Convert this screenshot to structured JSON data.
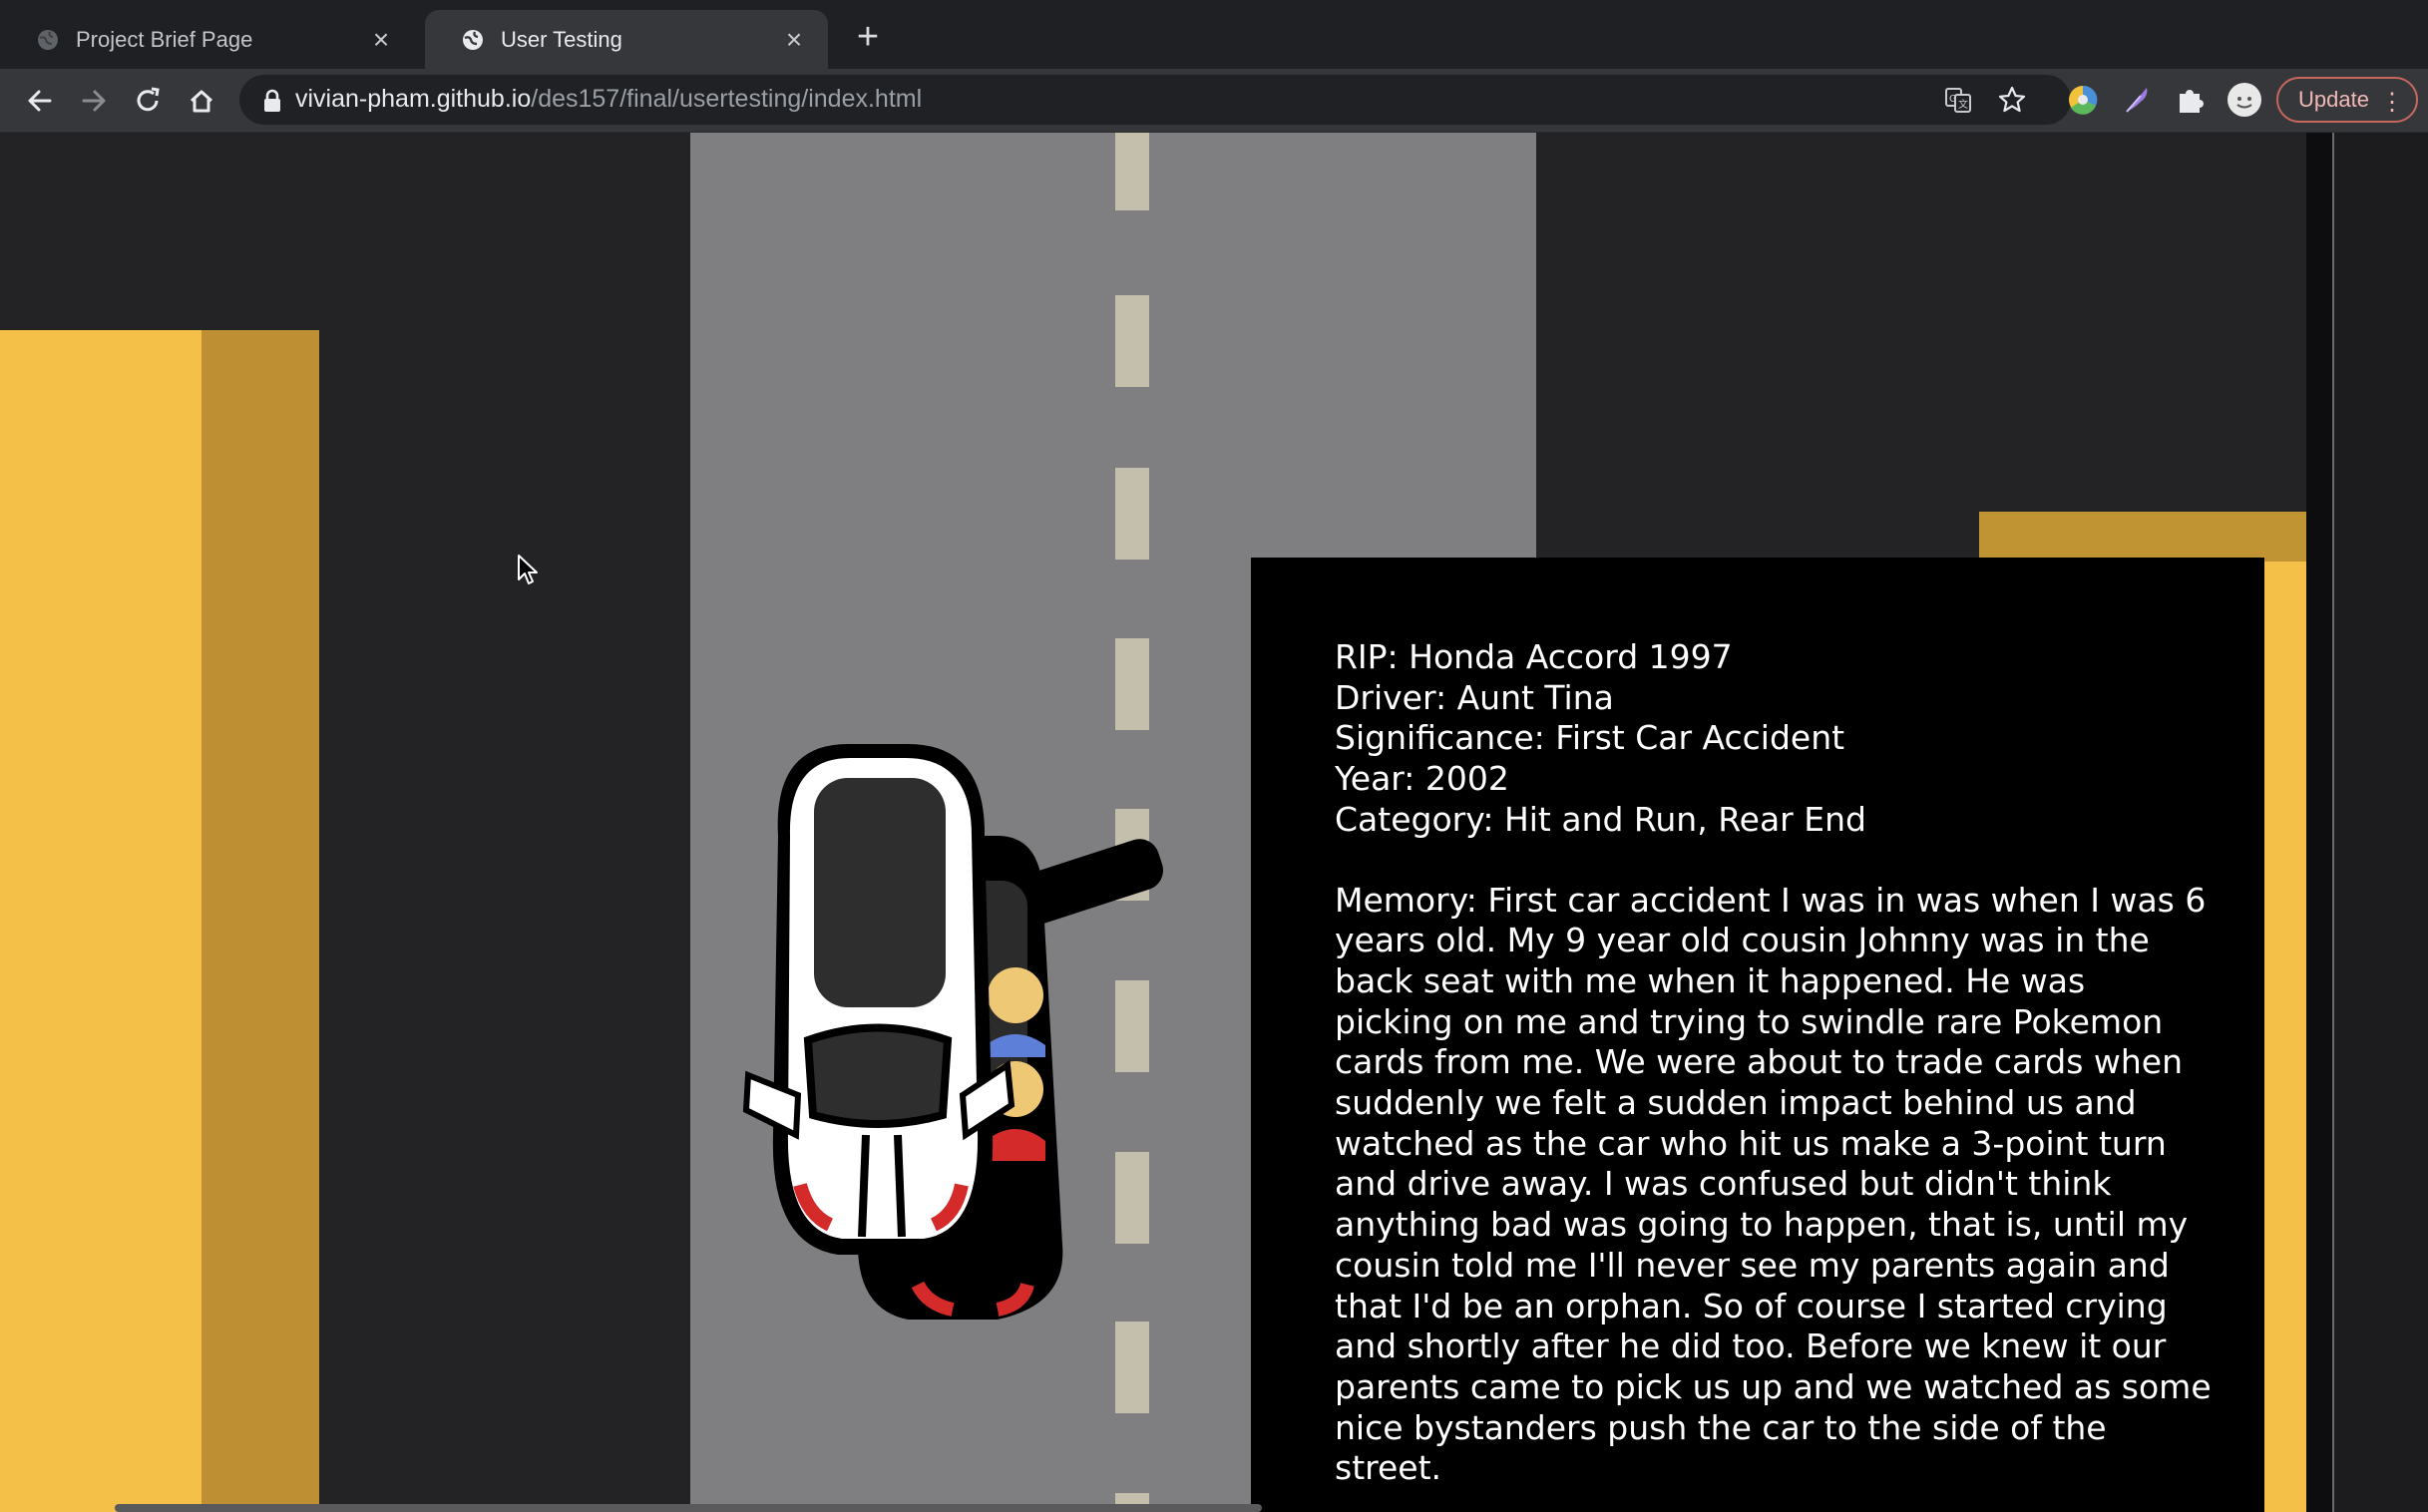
{
  "browser": {
    "tabs": [
      {
        "title": "Project Brief Page",
        "active": false
      },
      {
        "title": "User Testing",
        "active": true
      }
    ],
    "url_domain": "vivian-pham.github.io",
    "url_path": "/des157/final/usertesting/index.html",
    "update_label": "Update"
  },
  "icons": {
    "back": "back-arrow-icon",
    "forward": "forward-arrow-icon",
    "reload": "reload-icon",
    "home": "home-icon",
    "lock": "lock-icon",
    "translate": "translate-icon",
    "bookmark": "star-icon",
    "extensions": "puzzle-icon",
    "menu": "three-dots-icon"
  },
  "colors": {
    "road": "#7f7e80",
    "building_yellow": "#f4c047",
    "building_shadow": "#be9033",
    "lane_marking": "#c4bfac",
    "panel_bg": "#000000"
  },
  "memory_card": {
    "rip": "RIP: Honda Accord 1997",
    "driver": "Driver: Aunt Tina",
    "significance": "Significance: First Car Accident",
    "year": "Year: 2002",
    "category": "Category: Hit and Run, Rear End",
    "memory": "Memory: First car accident I was in was when I was 6 years old. My 9 year old cousin Johnny was in the back seat with me when it happened. He was picking on me and trying to swindle rare Pokemon cards from me. We were about to trade cards when suddenly we felt a sudden impact behind us and watched as the car who hit us make a 3-point turn and drive away. I was confused but didn't think anything bad was going to happen, that is, until my cousin told me I'll never see my parents again and that I'd be an orphan. So of course I started crying and shortly after he did too. Before we knew it our parents came to pick us up and we watched as some nice bystanders push the car to the side of the street."
  }
}
